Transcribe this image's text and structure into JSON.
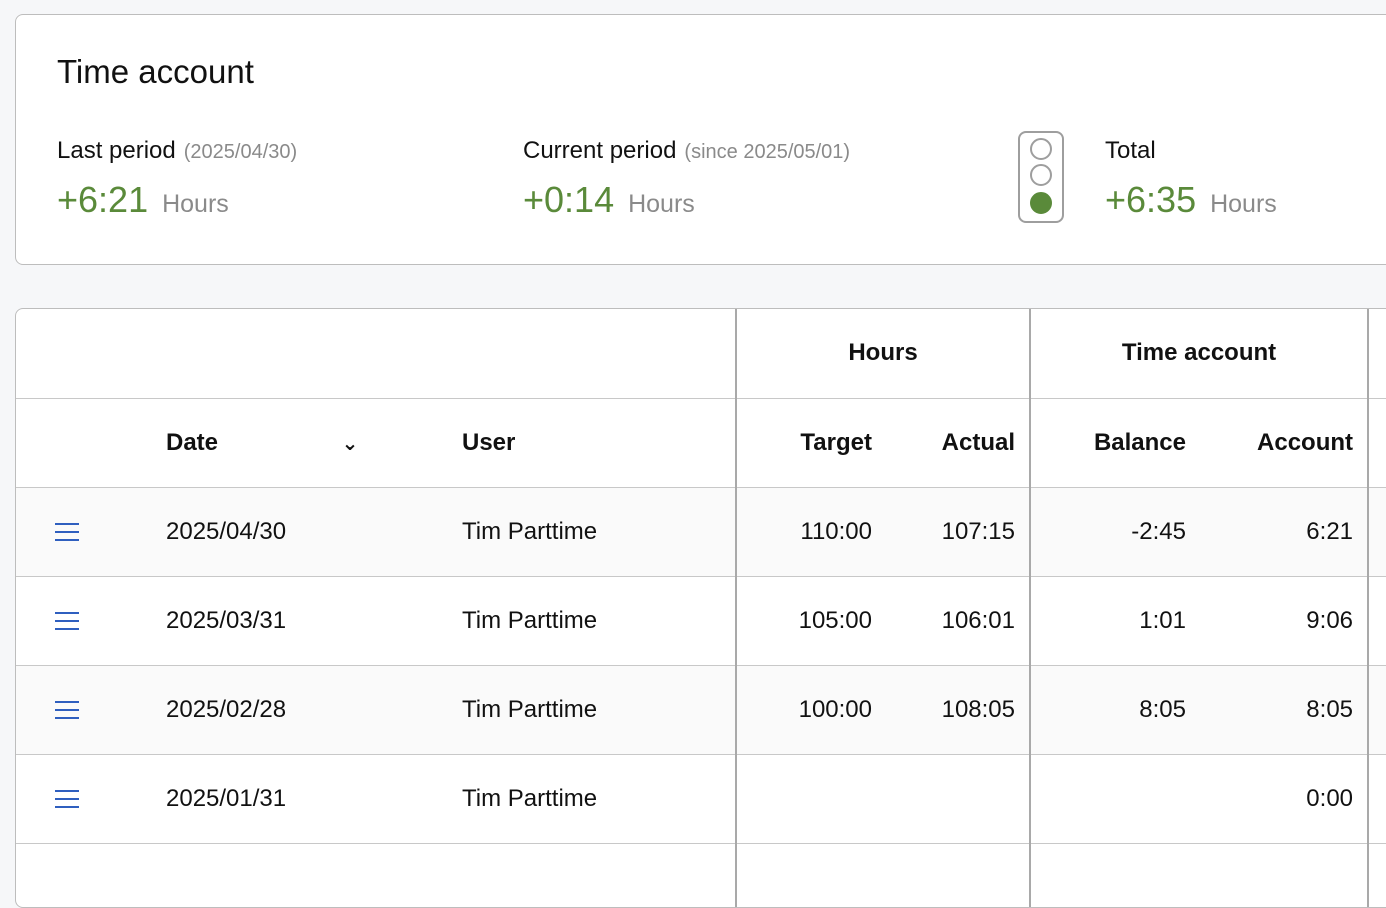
{
  "summary": {
    "title": "Time account",
    "last_period": {
      "label": "Last period",
      "note": "(2025/04/30)",
      "value": "+6:21",
      "unit": "Hours"
    },
    "current_period": {
      "label": "Current period",
      "note": "(since 2025/05/01)",
      "value": "+0:14",
      "unit": "Hours"
    },
    "traffic_light": {
      "icon": "traffic-light-icon",
      "active_light": "green",
      "active_color": "#5a8a3a"
    },
    "total": {
      "label": "Total",
      "value": "+6:35",
      "unit": "Hours"
    }
  },
  "table": {
    "group_headers": {
      "hours": "Hours",
      "time_account": "Time account"
    },
    "columns": {
      "date": "Date",
      "user": "User",
      "target": "Target",
      "actual": "Actual",
      "balance": "Balance",
      "account": "Account"
    },
    "sort_icon": "chevron-down-icon",
    "row_menu_icon": "menu-icon",
    "rows": [
      {
        "date": "2025/04/30",
        "user": "Tim Parttime",
        "target": "110:00",
        "actual": "107:15",
        "balance": "-2:45",
        "account": "6:21"
      },
      {
        "date": "2025/03/31",
        "user": "Tim Parttime",
        "target": "105:00",
        "actual": "106:01",
        "balance": "1:01",
        "account": "9:06"
      },
      {
        "date": "2025/02/28",
        "user": "Tim Parttime",
        "target": "100:00",
        "actual": "108:05",
        "balance": "8:05",
        "account": "8:05"
      },
      {
        "date": "2025/01/31",
        "user": "Tim Parttime",
        "target": "",
        "actual": "",
        "balance": "",
        "account": "0:00"
      }
    ]
  },
  "colors": {
    "positive": "#5a8a3a",
    "link_icon": "#2f5fbf"
  }
}
